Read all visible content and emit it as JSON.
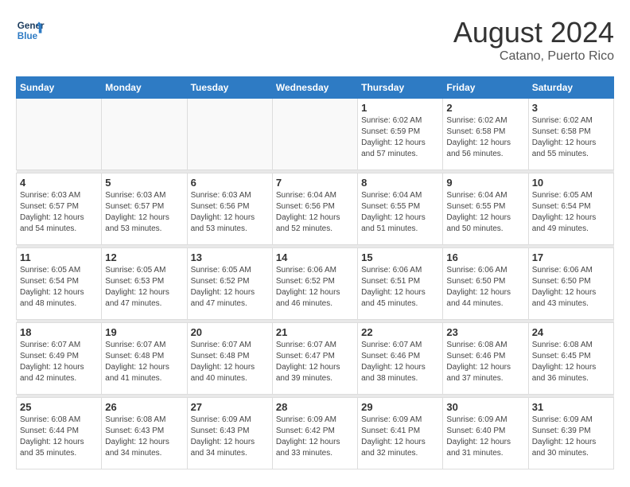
{
  "header": {
    "logo_line1": "General",
    "logo_line2": "Blue",
    "month_year": "August 2024",
    "location": "Catano, Puerto Rico"
  },
  "weekdays": [
    "Sunday",
    "Monday",
    "Tuesday",
    "Wednesday",
    "Thursday",
    "Friday",
    "Saturday"
  ],
  "weeks": [
    [
      {
        "day": "",
        "empty": true
      },
      {
        "day": "",
        "empty": true
      },
      {
        "day": "",
        "empty": true
      },
      {
        "day": "",
        "empty": true
      },
      {
        "day": "1",
        "sunrise": "6:02 AM",
        "sunset": "6:59 PM",
        "daylight": "12 hours and 57 minutes."
      },
      {
        "day": "2",
        "sunrise": "6:02 AM",
        "sunset": "6:58 PM",
        "daylight": "12 hours and 56 minutes."
      },
      {
        "day": "3",
        "sunrise": "6:02 AM",
        "sunset": "6:58 PM",
        "daylight": "12 hours and 55 minutes."
      }
    ],
    [
      {
        "day": "4",
        "sunrise": "6:03 AM",
        "sunset": "6:57 PM",
        "daylight": "12 hours and 54 minutes."
      },
      {
        "day": "5",
        "sunrise": "6:03 AM",
        "sunset": "6:57 PM",
        "daylight": "12 hours and 53 minutes."
      },
      {
        "day": "6",
        "sunrise": "6:03 AM",
        "sunset": "6:56 PM",
        "daylight": "12 hours and 53 minutes."
      },
      {
        "day": "7",
        "sunrise": "6:04 AM",
        "sunset": "6:56 PM",
        "daylight": "12 hours and 52 minutes."
      },
      {
        "day": "8",
        "sunrise": "6:04 AM",
        "sunset": "6:55 PM",
        "daylight": "12 hours and 51 minutes."
      },
      {
        "day": "9",
        "sunrise": "6:04 AM",
        "sunset": "6:55 PM",
        "daylight": "12 hours and 50 minutes."
      },
      {
        "day": "10",
        "sunrise": "6:05 AM",
        "sunset": "6:54 PM",
        "daylight": "12 hours and 49 minutes."
      }
    ],
    [
      {
        "day": "11",
        "sunrise": "6:05 AM",
        "sunset": "6:54 PM",
        "daylight": "12 hours and 48 minutes."
      },
      {
        "day": "12",
        "sunrise": "6:05 AM",
        "sunset": "6:53 PM",
        "daylight": "12 hours and 47 minutes."
      },
      {
        "day": "13",
        "sunrise": "6:05 AM",
        "sunset": "6:52 PM",
        "daylight": "12 hours and 47 minutes."
      },
      {
        "day": "14",
        "sunrise": "6:06 AM",
        "sunset": "6:52 PM",
        "daylight": "12 hours and 46 minutes."
      },
      {
        "day": "15",
        "sunrise": "6:06 AM",
        "sunset": "6:51 PM",
        "daylight": "12 hours and 45 minutes."
      },
      {
        "day": "16",
        "sunrise": "6:06 AM",
        "sunset": "6:50 PM",
        "daylight": "12 hours and 44 minutes."
      },
      {
        "day": "17",
        "sunrise": "6:06 AM",
        "sunset": "6:50 PM",
        "daylight": "12 hours and 43 minutes."
      }
    ],
    [
      {
        "day": "18",
        "sunrise": "6:07 AM",
        "sunset": "6:49 PM",
        "daylight": "12 hours and 42 minutes."
      },
      {
        "day": "19",
        "sunrise": "6:07 AM",
        "sunset": "6:48 PM",
        "daylight": "12 hours and 41 minutes."
      },
      {
        "day": "20",
        "sunrise": "6:07 AM",
        "sunset": "6:48 PM",
        "daylight": "12 hours and 40 minutes."
      },
      {
        "day": "21",
        "sunrise": "6:07 AM",
        "sunset": "6:47 PM",
        "daylight": "12 hours and 39 minutes."
      },
      {
        "day": "22",
        "sunrise": "6:07 AM",
        "sunset": "6:46 PM",
        "daylight": "12 hours and 38 minutes."
      },
      {
        "day": "23",
        "sunrise": "6:08 AM",
        "sunset": "6:46 PM",
        "daylight": "12 hours and 37 minutes."
      },
      {
        "day": "24",
        "sunrise": "6:08 AM",
        "sunset": "6:45 PM",
        "daylight": "12 hours and 36 minutes."
      }
    ],
    [
      {
        "day": "25",
        "sunrise": "6:08 AM",
        "sunset": "6:44 PM",
        "daylight": "12 hours and 35 minutes."
      },
      {
        "day": "26",
        "sunrise": "6:08 AM",
        "sunset": "6:43 PM",
        "daylight": "12 hours and 34 minutes."
      },
      {
        "day": "27",
        "sunrise": "6:09 AM",
        "sunset": "6:43 PM",
        "daylight": "12 hours and 34 minutes."
      },
      {
        "day": "28",
        "sunrise": "6:09 AM",
        "sunset": "6:42 PM",
        "daylight": "12 hours and 33 minutes."
      },
      {
        "day": "29",
        "sunrise": "6:09 AM",
        "sunset": "6:41 PM",
        "daylight": "12 hours and 32 minutes."
      },
      {
        "day": "30",
        "sunrise": "6:09 AM",
        "sunset": "6:40 PM",
        "daylight": "12 hours and 31 minutes."
      },
      {
        "day": "31",
        "sunrise": "6:09 AM",
        "sunset": "6:39 PM",
        "daylight": "12 hours and 30 minutes."
      }
    ]
  ]
}
